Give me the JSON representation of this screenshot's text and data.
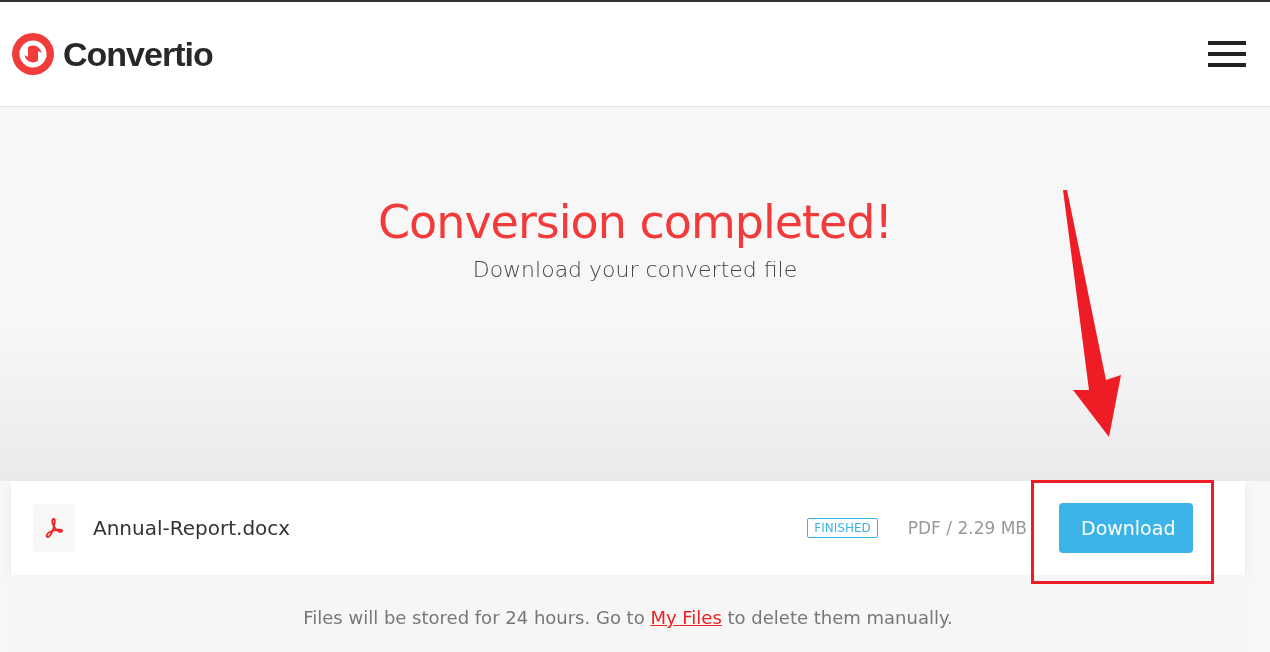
{
  "header": {
    "logo": "Convertio"
  },
  "hero": {
    "title": "Conversion completed!",
    "subtitle": "Download your converted file"
  },
  "file": {
    "name": "Annual-Report.docx",
    "status": "FINISHED",
    "info": "PDF / 2.29 MB",
    "button": "Download"
  },
  "note": {
    "before": "Files will be stored for 24 hours. Go to ",
    "link": "My Files",
    "after": " to delete them manually."
  }
}
